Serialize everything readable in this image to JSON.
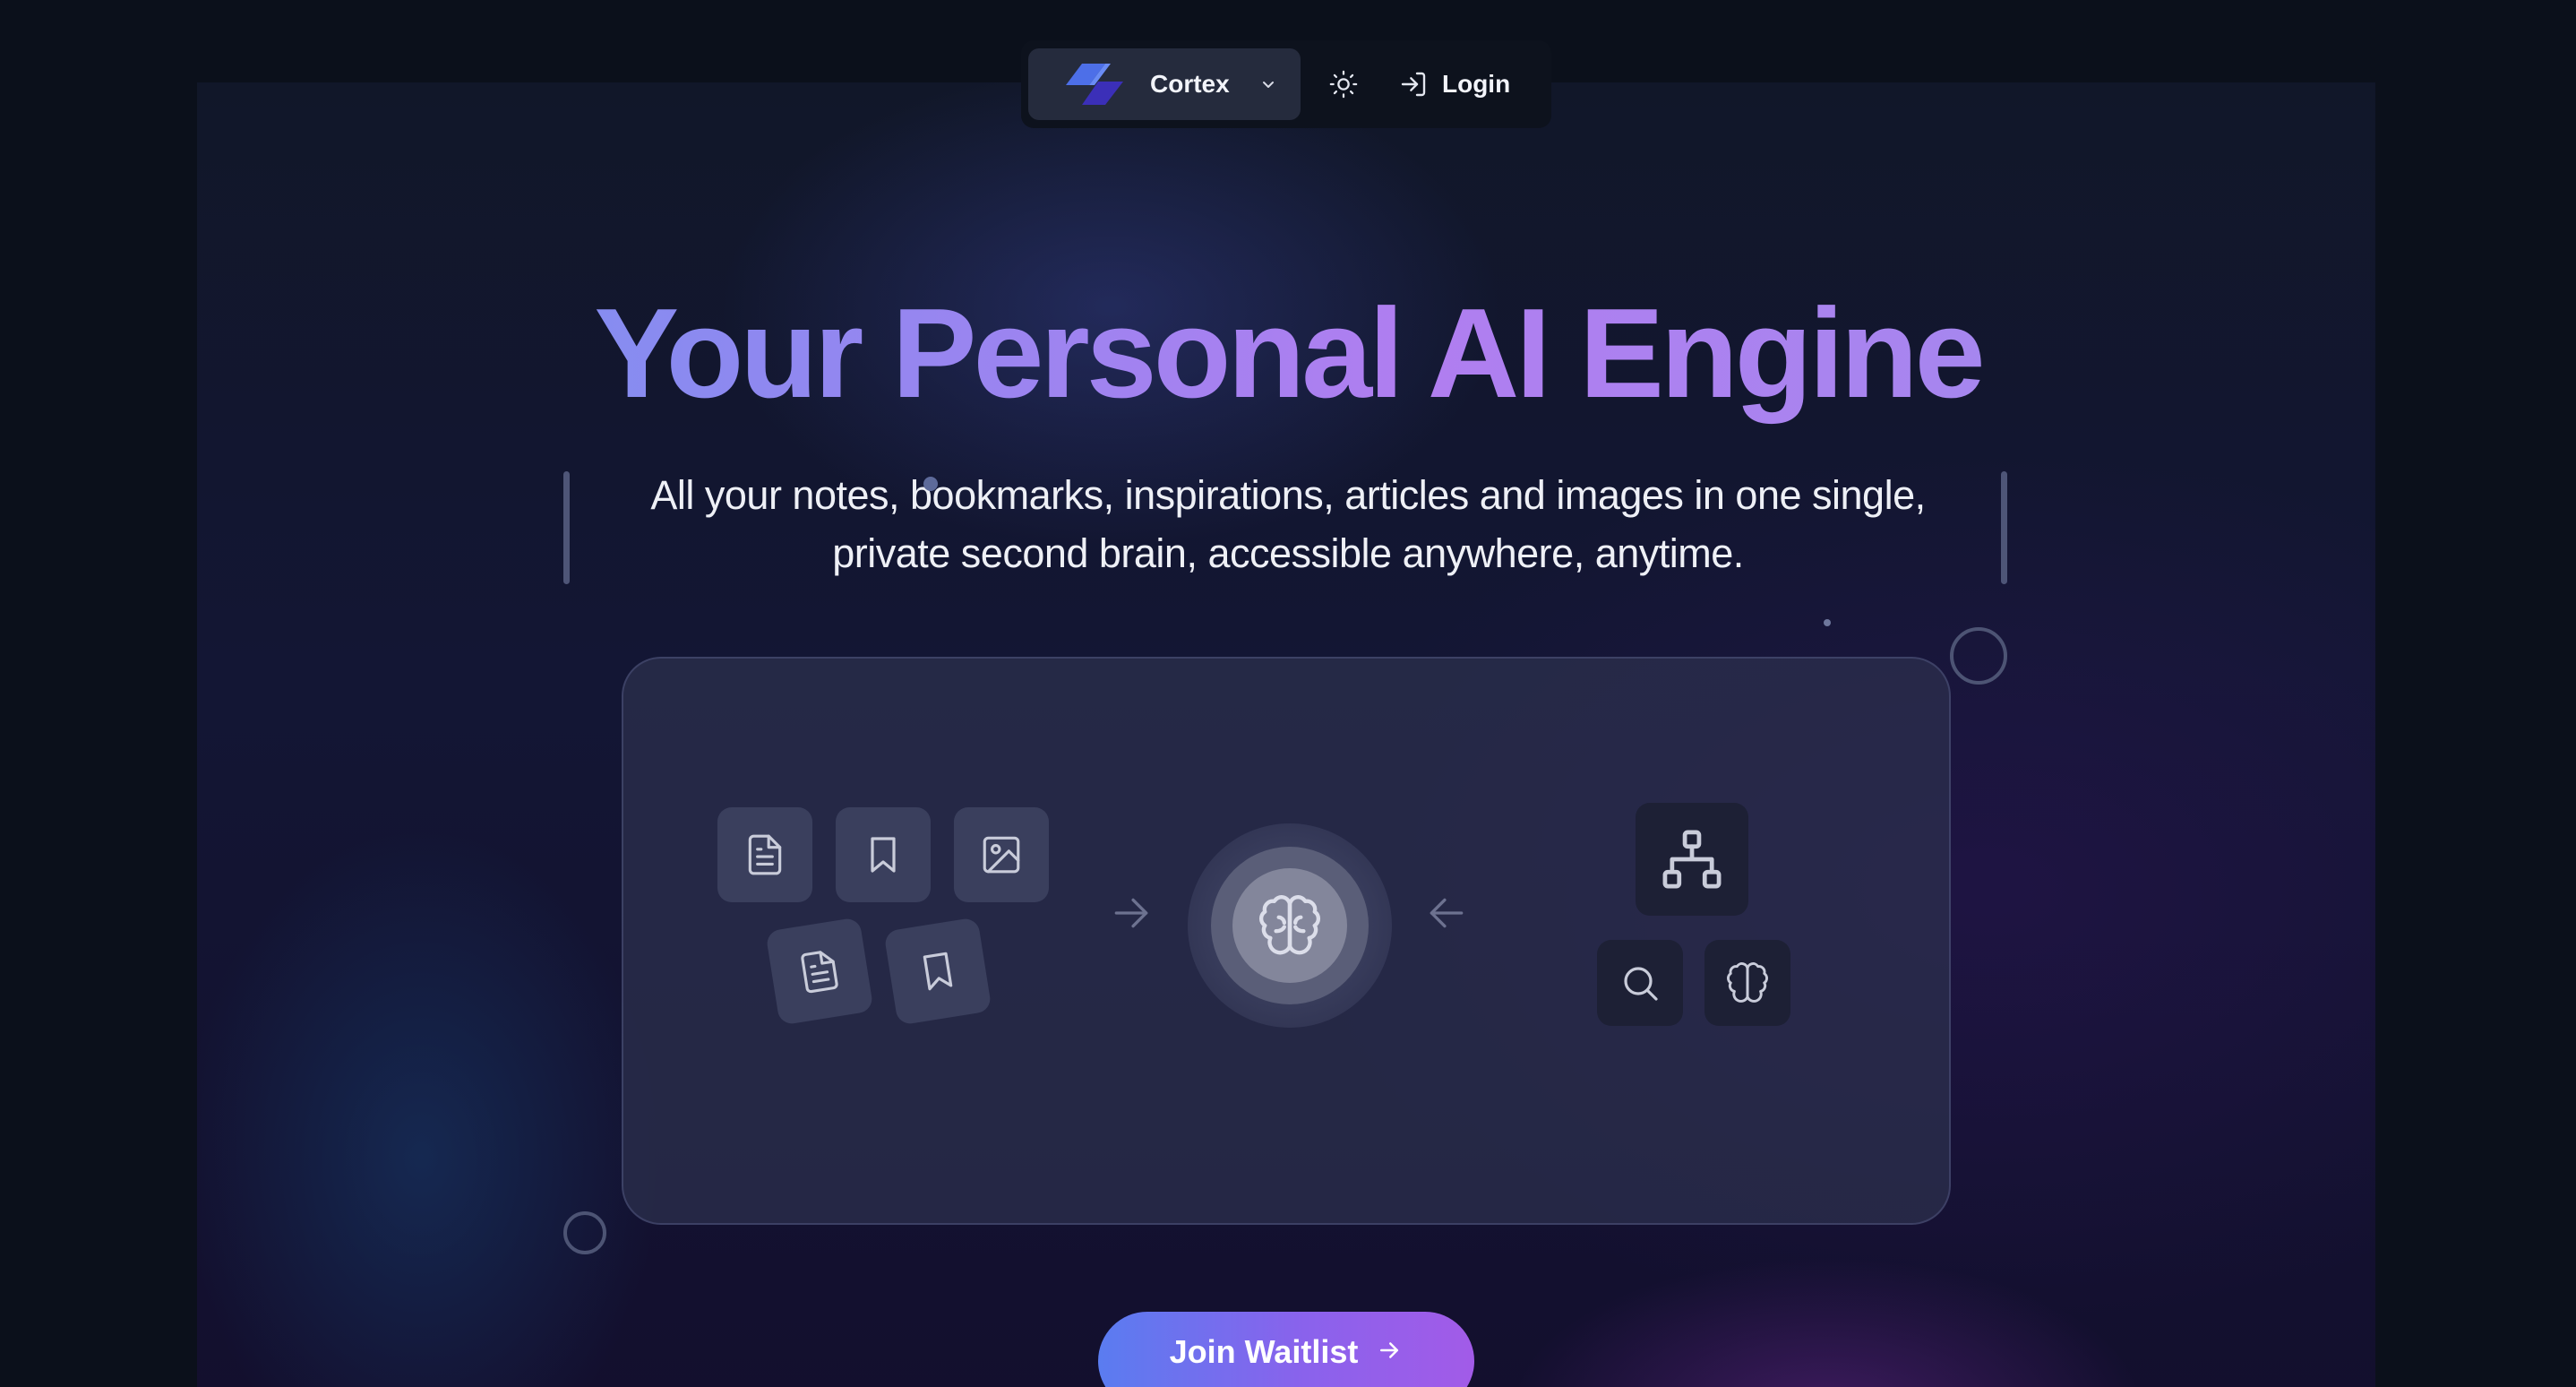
{
  "nav": {
    "brand": "Cortex",
    "login_label": "Login"
  },
  "hero": {
    "title": "Your Personal AI Engine",
    "subtitle_line1": "All your notes, bookmarks, inspirations, articles and images in one single,",
    "subtitle_line2": "private second brain, accessible anywhere, anytime."
  },
  "flow": {
    "inputs": [
      "document-icon",
      "bookmark-icon",
      "image-icon",
      "document-icon",
      "bookmark-icon"
    ],
    "hub": "brain-icon",
    "outputs": [
      "network-icon",
      "search-icon",
      "brain-icon"
    ]
  },
  "cta": {
    "label": "Join Waitlist"
  },
  "colors": {
    "background": "#0b101b",
    "accent_blue": "#6a9bf3",
    "accent_purple": "#b07ef0",
    "cta_start": "#5a7cf0",
    "cta_end": "#a25be8"
  }
}
